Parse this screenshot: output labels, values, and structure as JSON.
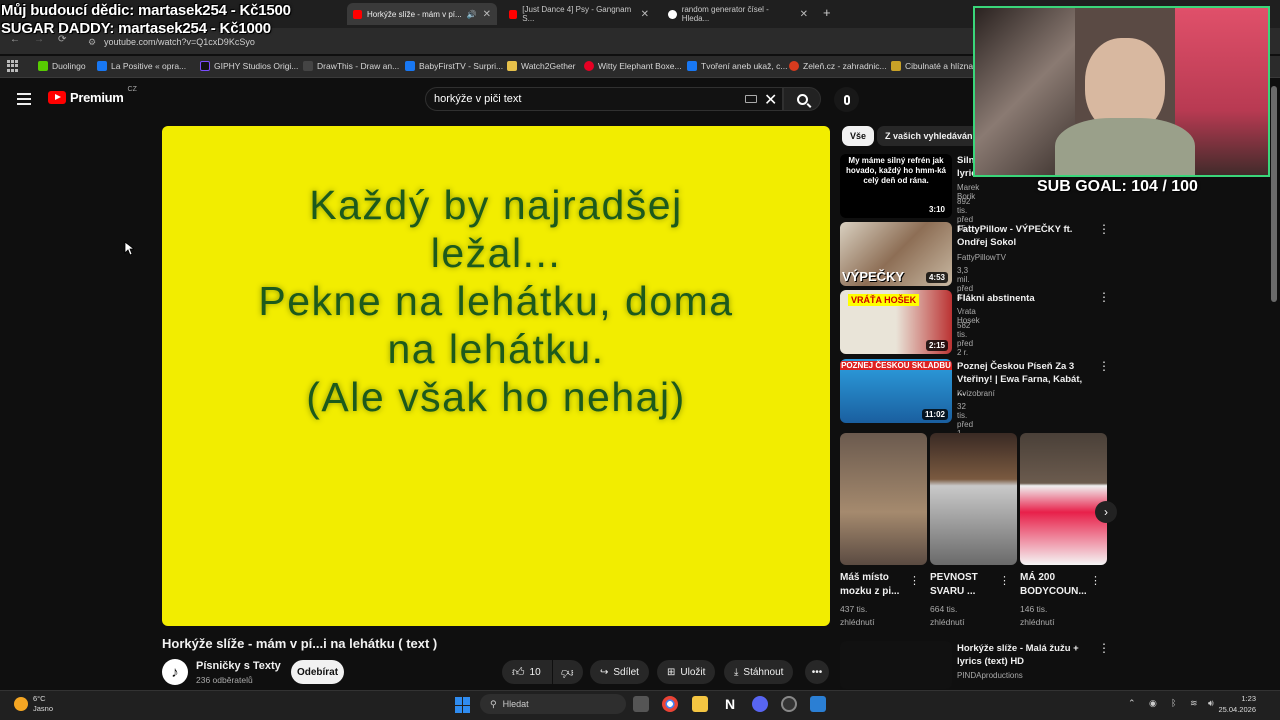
{
  "overlay": {
    "line1": "Můj budoucí dědic: martasek254 - Kč1500",
    "line2": "SUGAR DADDY: martasek254 - Kč1000",
    "sub_goal": "SUB GOAL: 104 / 100"
  },
  "browser": {
    "tabs": [
      {
        "label": "Horkýže slíže - mám v pí...",
        "active": true
      },
      {
        "label": "[Just Dance 4] Psy - Gangnam S...",
        "active": false
      },
      {
        "label": "random generator čísel - Hleda...",
        "active": false
      }
    ],
    "url": "youtube.com/watch?v=Q1cxD9KcSyo",
    "bookmarks": [
      "Duolingo",
      "La Positive « opra...",
      "GIPHY Studios Origi...",
      "DrawThis - Draw an...",
      "BabyFirstTV - Surpri...",
      "Watch2Gether",
      "Witty Elephant Boxe...",
      "Tvoření aneb ukaž, c...",
      "Zeleň.cz - zahradnic...",
      "Cibulnaté a hlíznat..."
    ]
  },
  "youtube": {
    "brand": "Premium",
    "country": "CZ",
    "search_value": "horkýže v piči text",
    "video": {
      "lyrics": [
        "Každý by najradšej",
        "ležal...",
        "Pekne na lehátku, doma",
        "na lehátku.",
        "(Ale však ho nehaj)"
      ],
      "title": "Horkýže slíže - mám v pí...i na lehátku ( text )",
      "channel": "Písničky s Texty",
      "subscribers": "236 odběratelů",
      "subscribe_label": "Odebírat",
      "likes": "10",
      "share_label": "Sdílet",
      "save_label": "Uložit",
      "download_label": "Stáhnout"
    },
    "chips": [
      "Vše",
      "Z vašich vyhledávání"
    ],
    "sidebar": [
      {
        "title": "Siln lyric",
        "channel": "Marek Borik",
        "meta": "892 tis.  před 15 l.",
        "duration": "3:10",
        "thumb_text": "My máme silný refrén jak hovado, každý ho hmm-ká celý deň od rána."
      },
      {
        "title": "FattyPillow - VÝPEČKY ft. Ondřej Sokol",
        "channel": "FattyPillowTV",
        "meta": "3,3 mil.  před 8 l.",
        "duration": "4:53",
        "thumb_text": "VÝPEČKY"
      },
      {
        "title": "Flákni abstinenta",
        "channel": "Vrata Hosek",
        "meta": "582 tis.  před 2 r.",
        "duration": "2:15",
        "thumb_text": "VRÁŤA HOŠEK"
      },
      {
        "title": "Poznej Českou Píseň Za 3 Vteřiny! | Ewa Farna, Kabát, ...",
        "channel": "Kvizobraní",
        "meta": "32 tis.  před 1 měs.",
        "duration": "11:02",
        "thumb_text": "POZNEJ ČESKOU SKLADBU"
      },
      {
        "title": "Horkýže slíže - Malá žužu + lyrics (text) HD",
        "channel": "PINDAproductions",
        "meta": "",
        "duration": "",
        "thumb_text": ""
      }
    ],
    "shorts": [
      {
        "title": "Máš místo mozku z pi...",
        "views": "437 tis.",
        "views2": "zhlédnutí"
      },
      {
        "title": "PEVNOST SVARU ...",
        "views": "664 tis.",
        "views2": "zhlédnutí"
      },
      {
        "title": "MÁ 200 BODYCOUN...",
        "views": "146 tis.",
        "views2": "zhlédnutí"
      }
    ]
  },
  "taskbar": {
    "temp": "6°C",
    "weather": "Jasno",
    "search_placeholder": "Hledat",
    "time": "1:23",
    "date": "25.04.2026"
  },
  "colors": {
    "player_bg": "#f2ed00",
    "lyrics": "#1c5a1c",
    "yt_red": "#ff0000",
    "cam_border": "#3ad67a"
  }
}
